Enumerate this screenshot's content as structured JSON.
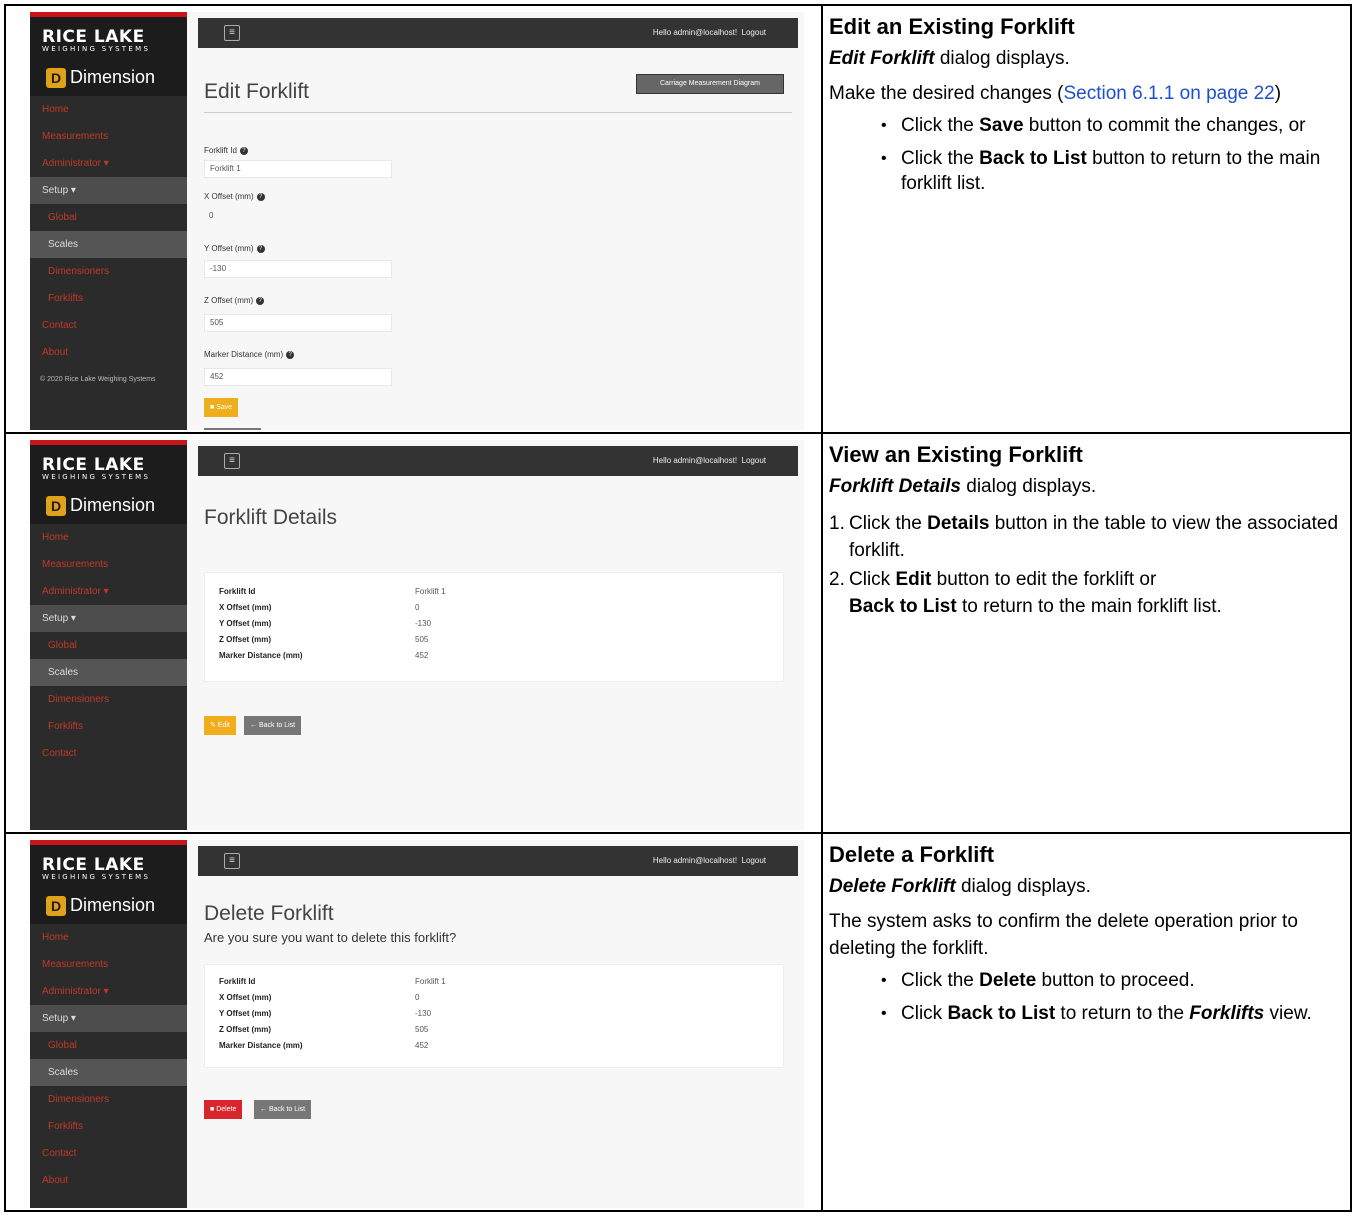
{
  "app": {
    "logo_text": "RICE LAKE",
    "logo_sub": "WEIGHING SYSTEMS",
    "brand_name": "Dimension",
    "greeting": "Hello admin@localhost!",
    "logout_label": "Logout",
    "footer": "© 2020 Rice Lake Weighing Systems"
  },
  "nav": {
    "home": "Home",
    "measurements": "Measurements",
    "administrator": "Administrator ▾",
    "setup": "Setup ▾",
    "global": "Global",
    "scales": "Scales",
    "dimensioners": "Dimensioners",
    "forklifts": "Forklifts",
    "contact": "Contact",
    "about": "About"
  },
  "fields": {
    "id_label": "Forklift Id",
    "x_label": "X Offset (mm)",
    "y_label": "Y Offset (mm)",
    "z_label": "Z Offset (mm)",
    "marker_label": "Marker Distance (mm)"
  },
  "values": {
    "id": "Forklift 1",
    "x": "0",
    "y": "-130",
    "z": "505",
    "marker": "452"
  },
  "buttons": {
    "save": "Save",
    "back": "← Back to List",
    "edit": "Edit",
    "delete": "Delete",
    "diagram": "Carriage Measurement Diagram"
  },
  "edit_section": {
    "page_title": "Edit Forklift",
    "heading": "Edit an Existing Forklift",
    "sub_bold": "Edit Forklift",
    "sub_rest": " dialog displays.",
    "intro_pre": "Make the desired changes (",
    "intro_link": "Section 6.1.1 on page 22",
    "intro_post": ")",
    "b1_pre": "Click the ",
    "b1_bold": "Save",
    "b1_post": " button to commit the changes, or",
    "b2_pre": "Click the ",
    "b2_bold": "Back to List",
    "b2_post": " button to return to the main forklift list."
  },
  "view_section": {
    "page_title": "Forklift Details",
    "heading": "View an Existing Forklift",
    "sub_bold": "Forklift Details",
    "sub_rest": " dialog displays.",
    "s1_num": "1.",
    "s1_pre": "Click the ",
    "s1_bold": "Details",
    "s1_post": " button in the table to view the associated forklift.",
    "s2_num": "2.",
    "s2_pre": "Click ",
    "s2_bold": "Edit",
    "s2_mid": " button to edit the forklift or",
    "s2_bold2": "Back to List",
    "s2_post": " to return to the main forklift list."
  },
  "delete_section": {
    "page_title": "Delete Forklift",
    "confirm": "Are you sure you want to delete this forklift?",
    "heading": "Delete a Forklift",
    "sub_bold": "Delete Forklift",
    "sub_rest": " dialog displays.",
    "intro": "The system asks to confirm the delete operation prior to deleting the forklift.",
    "b1_pre": "Click the ",
    "b1_bold": "Delete",
    "b1_post": " button to proceed.",
    "b2_pre": "Click ",
    "b2_bold": "Back to List",
    "b2_mid": " to return to the ",
    "b2_bold2": "Forklifts",
    "b2_post": " view."
  }
}
